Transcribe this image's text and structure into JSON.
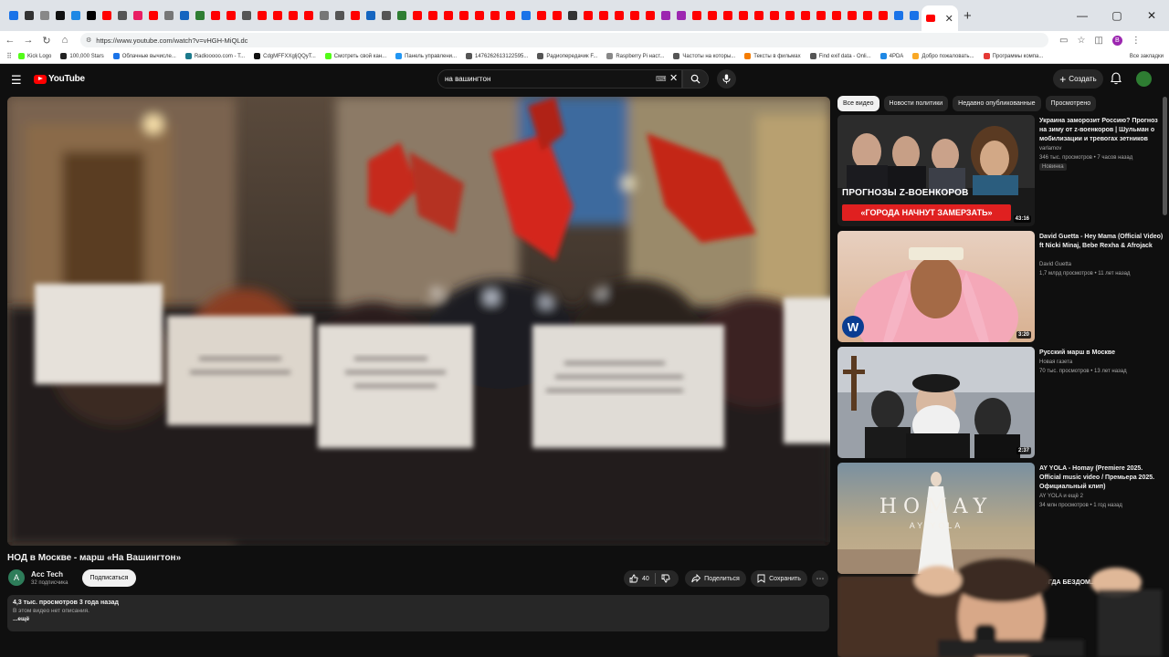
{
  "browser": {
    "url": "https://www.youtube.com/watch?v=vHGH-MiQLdc",
    "new_tab": "+",
    "win_min": "—",
    "win_max": "▢",
    "win_close": "✕",
    "tab_close": "✕",
    "profile_letter": "В",
    "bookmarks": [
      {
        "label": "Kick Logo",
        "color": "#53fc18"
      },
      {
        "label": "100,000 Stars",
        "color": "#222222"
      },
      {
        "label": "Облачные вычисле...",
        "color": "#1a73e8"
      },
      {
        "label": "Radiooooo.com - T...",
        "color": "#1c7a8c"
      },
      {
        "label": "CdgMFFXXgljQQyT...",
        "color": "#111111"
      },
      {
        "label": "Смотреть свой кан...",
        "color": "#53fc18"
      },
      {
        "label": "Панель управлени...",
        "color": "#2196f3"
      },
      {
        "label": "1476262613122595...",
        "color": "#555555"
      },
      {
        "label": "Радиопередачик F...",
        "color": "#555555"
      },
      {
        "label": "Raspberry Pi наст...",
        "color": "#888888"
      },
      {
        "label": "Частоты на которы...",
        "color": "#555555"
      },
      {
        "label": "Тексты в фильмах",
        "color": "#f57c00"
      },
      {
        "label": "Find exif data - Onli...",
        "color": "#555555"
      },
      {
        "label": "4PDA",
        "color": "#1e88e5"
      },
      {
        "label": "Добро пожаловать...",
        "color": "#f9a825"
      },
      {
        "label": "Программы компа...",
        "color": "#e53935"
      }
    ],
    "bookmarks_all": "Все закладки"
  },
  "header": {
    "logo_text": "YouTube",
    "search_query": "на вашингтон",
    "create_label": "Создать"
  },
  "video": {
    "title": "НОД в Москве - марш «На Вашингтон»",
    "channel_initial": "A",
    "channel_name": "Acc Tech",
    "channel_subs": "32 подписчика",
    "subscribe_label": "Подписаться",
    "likes": "40",
    "share_label": "Поделиться",
    "save_label": "Сохранить",
    "more_label": "⋯",
    "views_date": "4,3 тыс. просмотров  3 года назад",
    "description": "В этом видео нет описания.",
    "more_text": "...ещё"
  },
  "chips": [
    "Все видео",
    "Новости политики",
    "Недавно опубликованные",
    "Просмотрено"
  ],
  "recommendations": [
    {
      "title": "Украина заморозит Россию? Прогноз на зиму от z-военкоров | Шульман о мобилизации и тревогах зетников",
      "channel": "varlamov",
      "meta": "346 тыс. просмотров • 7 часов назад",
      "badge": "Новинка",
      "duration": "43:16",
      "overlay_top": "ПРОГНОЗЫ Z-ВОЕНКОРОВ",
      "overlay_bottom": "«ГОРОДА НАЧНУТ ЗАМЕРЗАТЬ»"
    },
    {
      "title": "David Guetta - Hey Mama (Official Video) ft Nicki Minaj, Bebe Rexha & Afrojack",
      "channel": "David Guetta",
      "meta": "1,7 млрд просмотров • 11 лет назад",
      "duration": "3:20"
    },
    {
      "title": "Русский марш в Москве",
      "channel": "Новая газета",
      "meta": "70 тыс. просмотров • 13 лет назад",
      "duration": "2:37"
    },
    {
      "title": "AY YOLA - Homay (Premiere 2025. Official music video / Премьера 2025. Официальный клип)",
      "channel": "AY YOLA  и ещё 2",
      "meta": "34 млн просмотров • 1 год назад",
      "overlay_top": "HOMAY",
      "overlay_bottom": "AY YOLA"
    },
    {
      "title": "КОГДА БЕЗДОМ... ...АРУ"
    }
  ],
  "colors": {
    "background": "#0f0f0f",
    "accent_red": "#ff0000",
    "chip_active": "#f1f1f1",
    "surface": "#272727"
  }
}
